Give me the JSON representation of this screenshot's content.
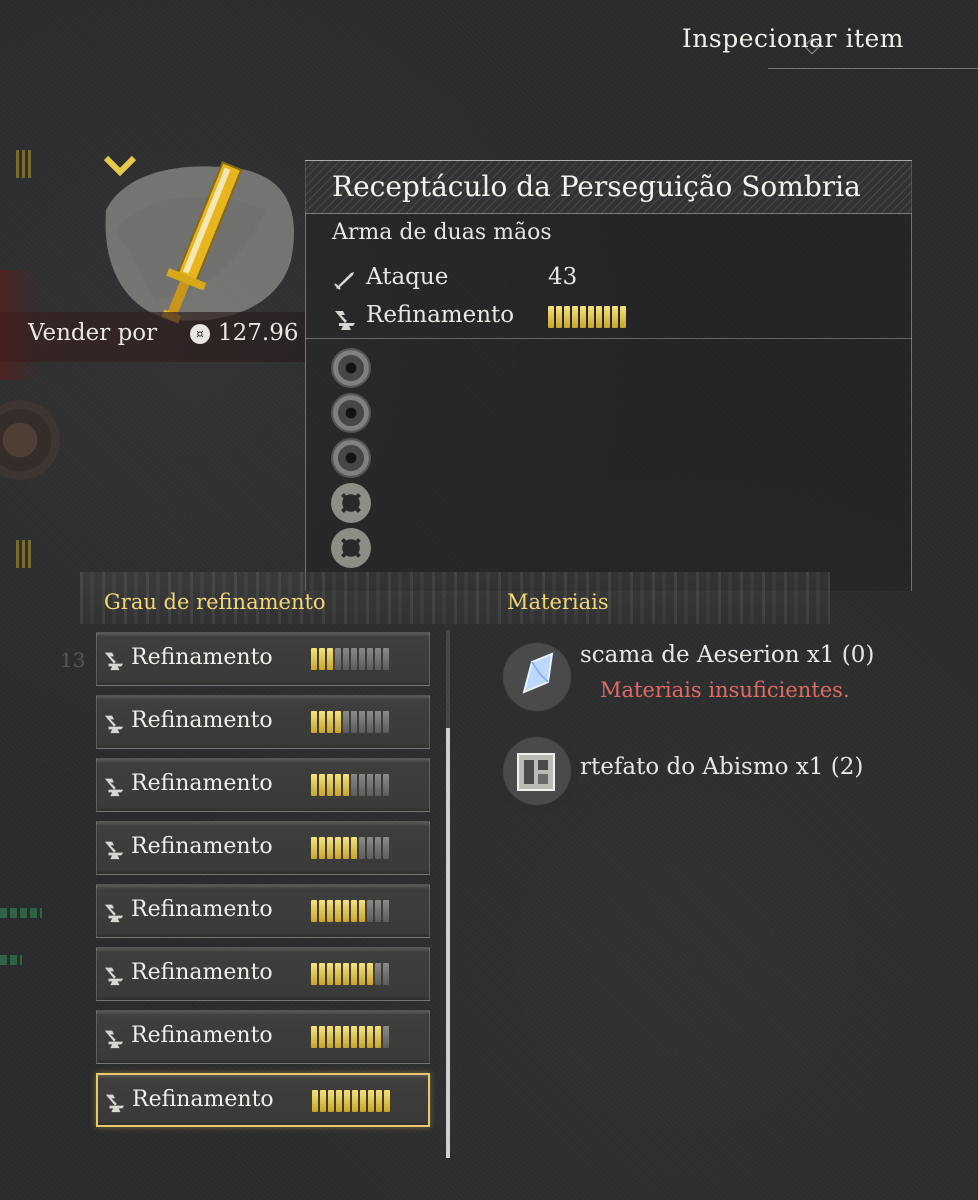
{
  "header": {
    "title": "Inspecionar item"
  },
  "sell": {
    "label": "Vender por",
    "coin_icon": "coin-icon",
    "value": "127.96"
  },
  "item": {
    "name": "Receptáculo da Perseguição Sombria",
    "type": "Arma de duas mãos",
    "stats": {
      "attack_label": "Ataque",
      "attack_value": "43",
      "refine_label": "Refinamento",
      "refine_filled": 10,
      "refine_total": 10
    },
    "slots": [
      "empty-slot",
      "empty-slot",
      "empty-slot",
      "cross-slot",
      "cross-slot"
    ]
  },
  "grade_section": {
    "header": "Grau de refinamento",
    "rows": [
      {
        "label": "Refinamento",
        "filled": 3,
        "total": 10,
        "selected": false
      },
      {
        "label": "Refinamento",
        "filled": 4,
        "total": 10,
        "selected": false
      },
      {
        "label": "Refinamento",
        "filled": 5,
        "total": 10,
        "selected": false
      },
      {
        "label": "Refinamento",
        "filled": 6,
        "total": 10,
        "selected": false
      },
      {
        "label": "Refinamento",
        "filled": 7,
        "total": 10,
        "selected": false
      },
      {
        "label": "Refinamento",
        "filled": 8,
        "total": 10,
        "selected": false
      },
      {
        "label": "Refinamento",
        "filled": 9,
        "total": 10,
        "selected": false
      },
      {
        "label": "Refinamento",
        "filled": 10,
        "total": 10,
        "selected": true
      }
    ]
  },
  "materials": {
    "header": "Materiais",
    "items": [
      {
        "name": "scama de Aeserion x1 (0)",
        "warning": "Materiais insuficientes.",
        "icon": "crystal-scale-icon"
      },
      {
        "name": "rtefato do Abismo x1 (2)",
        "warning": "",
        "icon": "abyss-artifact-icon"
      }
    ]
  },
  "colors": {
    "accent_gold": "#f2d774",
    "bar_on": "#e8c84a",
    "bar_off": "#707070",
    "warning": "#e06b63"
  }
}
